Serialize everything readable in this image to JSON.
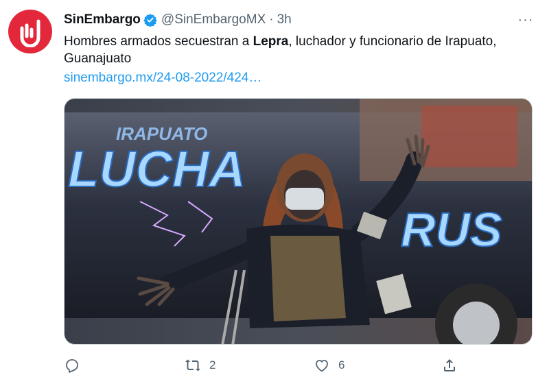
{
  "tweet": {
    "display_name": "SinEmbargo",
    "handle": "@SinEmbargoMX",
    "separator": "·",
    "time": "3h",
    "more_label": "···",
    "text_before": "Hombres armados secuestran a ",
    "text_bold": "Lepra",
    "text_after": ", luchador y funcionario de Irapuato, Guanajuato",
    "link": "sinembargo.mx/24-08-2022/424…"
  },
  "photo": {
    "mural_title_small": "IRAPUATO",
    "mural_title_large": "LUCHA",
    "mural_title_right": "RUS"
  },
  "actions": {
    "reply_icon": "reply-icon",
    "retweet_icon": "retweet-icon",
    "retweet_count": "2",
    "like_icon": "heart-icon",
    "like_count": "6",
    "share_icon": "share-icon"
  },
  "colors": {
    "brand_red": "#e3283c",
    "link_blue": "#1d9bf0",
    "verified_blue": "#1d9bf0",
    "muted_gray": "#536471"
  }
}
